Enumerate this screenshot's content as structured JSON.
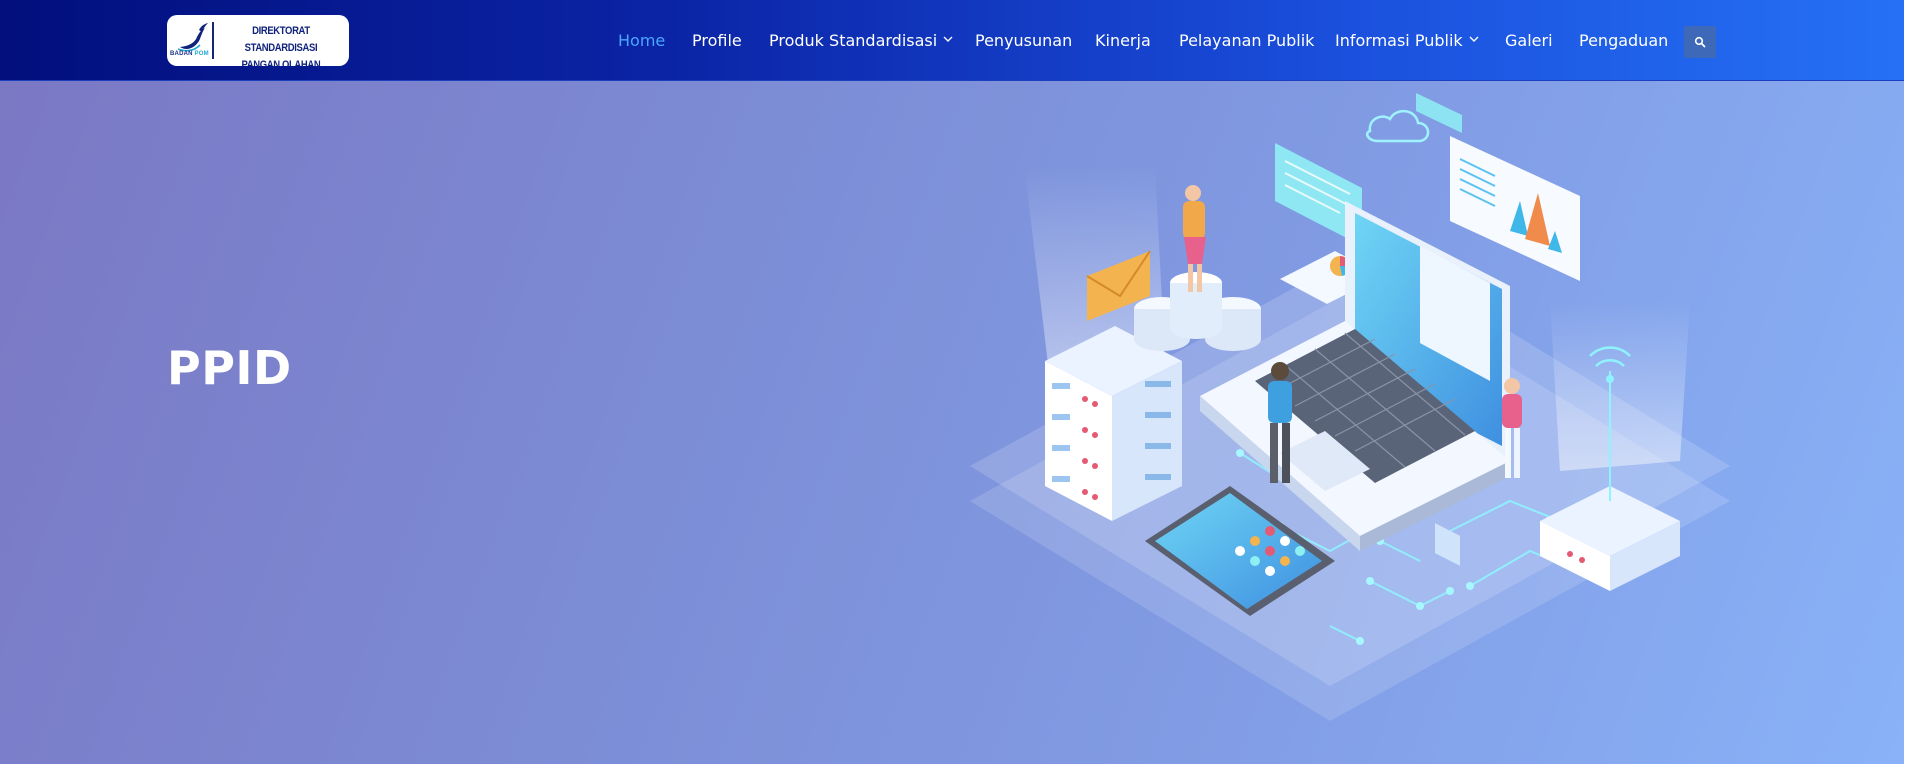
{
  "brand": {
    "line1": "DIREKTORAT STANDARDISASI",
    "line2": "PANGAN OLAHAN",
    "agency_prefix": "BADAN",
    "agency_suffix": "POM",
    "logo_icon": "bird-emblem-icon"
  },
  "nav": {
    "items": [
      {
        "label": "Home",
        "active": true
      },
      {
        "label": "Profile"
      },
      {
        "label": "Produk Standardisasi",
        "dropdown": true
      },
      {
        "label": "Penyusunan"
      },
      {
        "label": "Kinerja"
      },
      {
        "label": "Pelayanan Publik"
      },
      {
        "label": "Informasi Publik",
        "dropdown": true
      },
      {
        "label": "Galeri"
      },
      {
        "label": "Pengaduan"
      }
    ],
    "search_icon": "search-icon"
  },
  "hero": {
    "title": "PPID",
    "illustration": "isometric-laptop-data-network-illustration"
  },
  "colors": {
    "header_start": "#020f7c",
    "header_end": "#2571f5",
    "nav_active": "#4aa6ff",
    "hero_start": "#7b78c4",
    "hero_end": "#89b2f8",
    "search_button": "#3d69b8"
  }
}
